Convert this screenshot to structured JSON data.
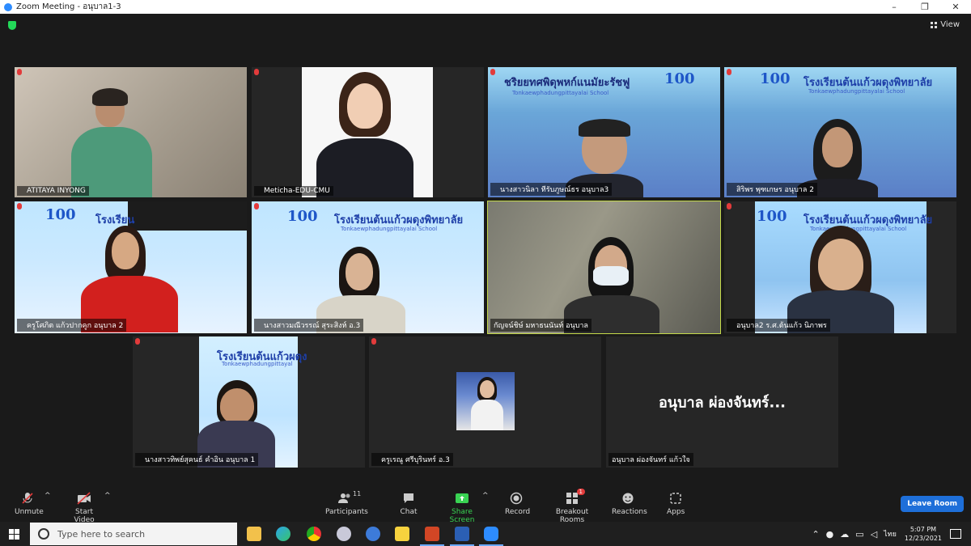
{
  "window": {
    "title": "Zoom Meeting - อนุบาล1-3",
    "view_label": "View"
  },
  "tiles": [
    {
      "name": "ATITAYA INYONG",
      "muted": true
    },
    {
      "name": "Meticha-EDU-CMU",
      "muted": true
    },
    {
      "name": "นางสาวนิลา ทีรับภูษณ์ธร อนุบาล3",
      "muted": true,
      "banner_text": "ชริยยทศพิดุพหก์แนมัยะรัชฟู",
      "banner_sub": "Tonkaewphadungpittayalai School"
    },
    {
      "name": "สิริพร พุฑเกษร อนุบาล 2",
      "muted": true,
      "banner_text": "โรงเรียนต้นแก้วผดุงพิทยาลัย",
      "banner_sub": "Tonkaewphadungpittayalai School"
    },
    {
      "name": "ครูโศภิต แก้วปากคูก อนุบาล 2",
      "muted": true,
      "banner_text": "โรงเรียน"
    },
    {
      "name": "นางสาวมณีวรรณ์ สุระสิงห์ อ.3",
      "muted": true,
      "banner_text": "โรงเรียนต้นแก้วผดุงพิทยาลัย",
      "banner_sub": "Tonkaewphadungpittayalai School"
    },
    {
      "name": "กัญจน์ชิษ์ มหาธนนันท์ อนุบาล",
      "muted": false,
      "active": true
    },
    {
      "name": "อนุบาล2 ร.ศ.ต้นแก้ว นิภาพร",
      "muted": true,
      "banner_text": "โรงเรียนต้นแก้วผดุงพิทยาลัย",
      "banner_sub": "Tonkaewphadungpittayalai School"
    },
    {
      "name": "นางสาวทิพย์สุคนธ์ คำอิน อนุบาล 1",
      "muted": true,
      "banner_text": "โรงเรียนต้นแก้วผดุง",
      "banner_sub": "Tonkaewphadungpittayal"
    },
    {
      "name": "ครูเรณู ศรีบุรินทร์ อ.3",
      "muted": true
    },
    {
      "name": "อนุบาล ผ่องจันทร์ แก้วใจ",
      "muted": false,
      "display": "อนุบาล ผ่องจันทร์..."
    }
  ],
  "logo_text": "100",
  "toolbar": {
    "unmute": "Unmute",
    "start_video": "Start Video",
    "participants": "Participants",
    "participants_count": "11",
    "chat": "Chat",
    "share_screen": "Share Screen",
    "record": "Record",
    "breakout_rooms": "Breakout Rooms",
    "breakout_badge": "1",
    "reactions": "Reactions",
    "apps": "Apps",
    "leave": "Leave Room"
  },
  "taskbar": {
    "search_placeholder": "Type here to search",
    "lang": "ไทย",
    "time": "5:07 PM",
    "date": "12/23/2021"
  },
  "colors": {
    "accent": "#2d8cff",
    "leave": "#1e6fd9",
    "share": "#39d353",
    "active_border": "#c4d94a",
    "mute": "#e23b3b"
  }
}
